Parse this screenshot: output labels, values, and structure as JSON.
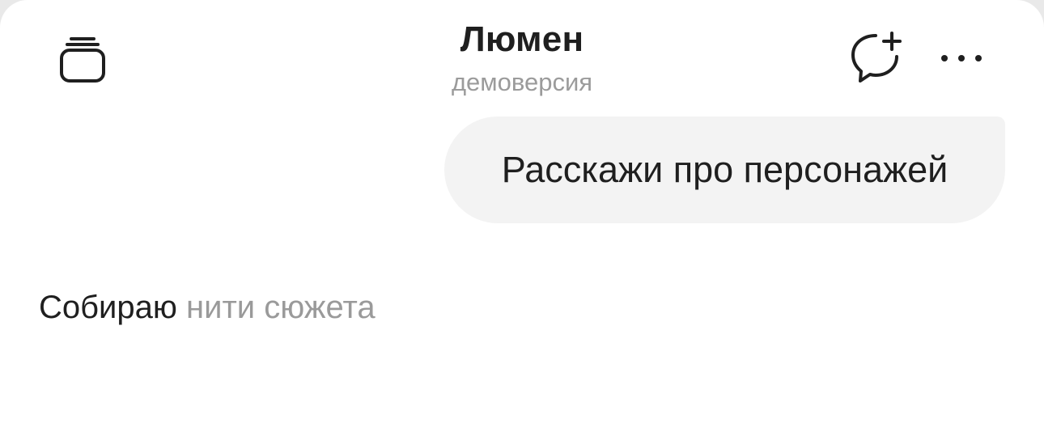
{
  "header": {
    "title": "Люмен",
    "subtitle": "демоверсия"
  },
  "icons": {
    "history": "stacked-cards-icon",
    "new_chat": "chat-bubble-plus-icon",
    "more": "more-horizontal-icon"
  },
  "messages": [
    {
      "role": "user",
      "text": "Расскажи про персонажей"
    }
  ],
  "status": {
    "primary": "Собираю",
    "secondary": "нити сюжета"
  },
  "colors": {
    "text": "#1f1f1f",
    "muted": "#9b9b9b",
    "bubble": "#f3f3f3",
    "background": "#ffffff"
  }
}
